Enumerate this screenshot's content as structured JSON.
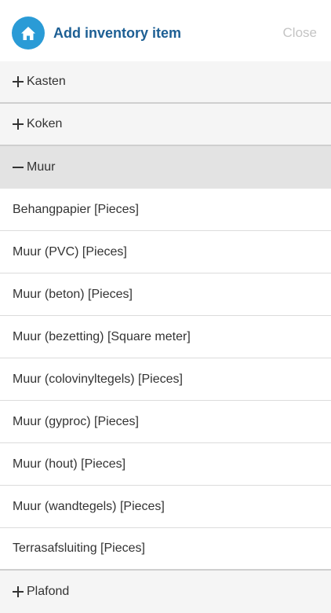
{
  "header": {
    "title": "Add inventory item",
    "close_label": "Close",
    "home_icon": "home-icon",
    "accent_color": "#2a9bd6",
    "title_color": "#1d5f94"
  },
  "groups": [
    {
      "label": "Kasten",
      "expanded": false
    },
    {
      "label": "Koken",
      "expanded": false
    },
    {
      "label": "Muur",
      "expanded": true
    },
    {
      "label": "Plafond",
      "expanded": false
    }
  ],
  "muur_items": [
    "Behangpapier [Pieces]",
    "Muur (PVC) [Pieces]",
    "Muur (beton) [Pieces]",
    "Muur (bezetting) [Square meter]",
    "Muur (colovinyltegels) [Pieces]",
    "Muur (gyproc) [Pieces]",
    "Muur (hout) [Pieces]",
    "Muur (wandtegels) [Pieces]",
    "Terrasafsluiting [Pieces]"
  ]
}
